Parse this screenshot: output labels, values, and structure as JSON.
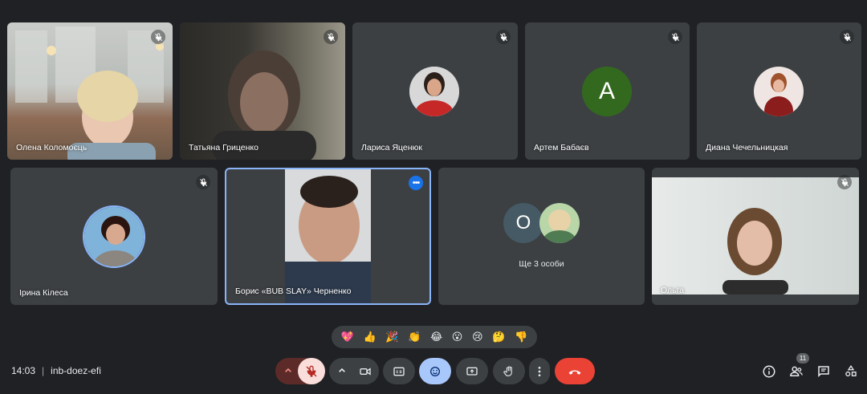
{
  "participants": [
    {
      "name": "Олена Коломоєць",
      "type": "video",
      "muted": true
    },
    {
      "name": "Татьяна Гриценко",
      "type": "video",
      "muted": true
    },
    {
      "name": "Лариса Яценюк",
      "type": "photo",
      "muted": true
    },
    {
      "name": "Артем Бабаєв",
      "type": "letter",
      "letter": "A",
      "color": "#33691e",
      "muted": true
    },
    {
      "name": "Диана Чечельницкая",
      "type": "photo",
      "muted": true
    },
    {
      "name": "Ірина Кілеса",
      "type": "photo",
      "muted": true
    },
    {
      "name": "Борис «BUB SLAY» Черненко",
      "type": "video",
      "muted": false,
      "active": true
    },
    {
      "name": "Ольга",
      "type": "video",
      "muted": true
    }
  ],
  "others_tile": {
    "label": "Ще 3 особи",
    "letter": "О",
    "letter_color": "#455a64"
  },
  "active_more_icon": "more-horiz-icon",
  "reactions": [
    "💖",
    "👍",
    "🎉",
    "👏",
    "😂",
    "😮",
    "😢",
    "🤔",
    "👎"
  ],
  "meeting": {
    "time": "14:03",
    "separator": "|",
    "code": "inb-doez-efi"
  },
  "people_count": "11",
  "colors": {
    "background": "#202124",
    "tile": "#3c4043",
    "accent": "#1a73e8",
    "mic_off": "#f9dedc",
    "end_call": "#ea4335",
    "reaction_active": "#a8c7fa"
  }
}
